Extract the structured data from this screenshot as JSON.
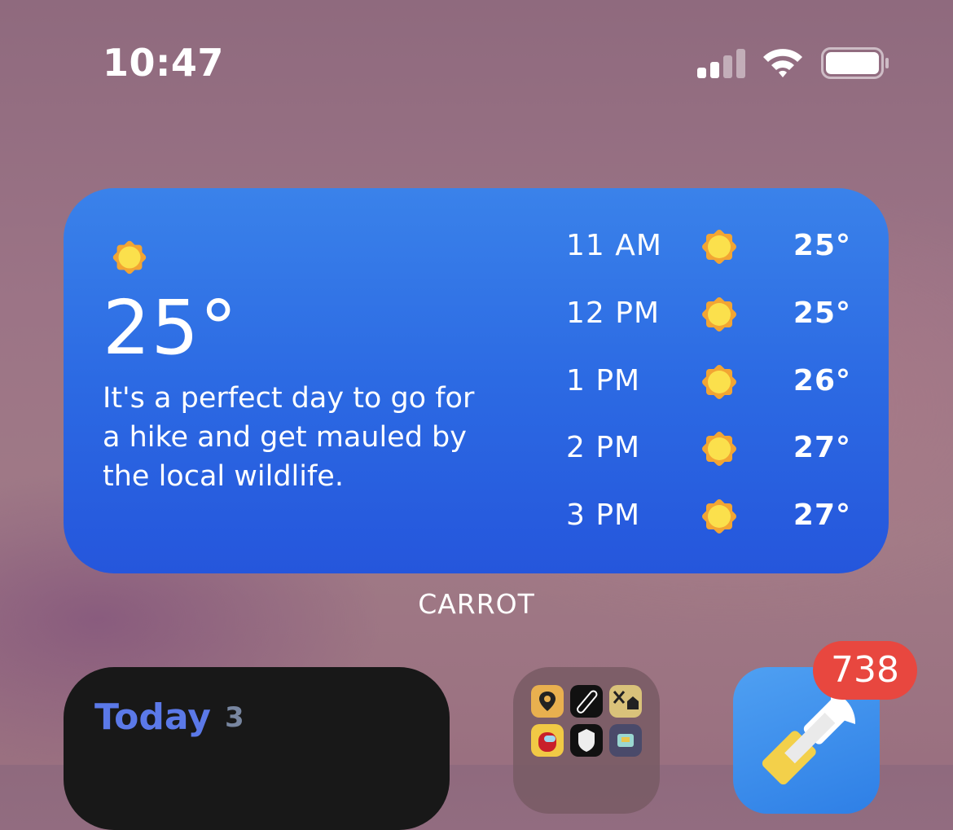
{
  "status_bar": {
    "time": "10:47",
    "signal_icon": "cellular-signal-icon",
    "wifi_icon": "wifi-icon",
    "battery_icon": "battery-icon"
  },
  "weather_widget": {
    "current_icon": "sun-icon",
    "current_temp": "25°",
    "description": "It's a perfect day to go for a hike and get mauled by the local wildlife.",
    "hourly": [
      {
        "time": "11 AM",
        "icon": "sun-icon",
        "temp": "25°"
      },
      {
        "time": "12 PM",
        "icon": "sun-icon",
        "temp": "25°"
      },
      {
        "time": "1 PM",
        "icon": "sun-icon",
        "temp": "26°"
      },
      {
        "time": "2 PM",
        "icon": "sun-icon",
        "temp": "27°"
      },
      {
        "time": "3 PM",
        "icon": "sun-icon",
        "temp": "27°"
      }
    ],
    "caption": "CARROT"
  },
  "reminders_widget": {
    "title": "Today",
    "count": "3"
  },
  "folder": {
    "apps": [
      "map-pin-icon",
      "skateboard-icon",
      "tools-house-icon",
      "among-us-icon",
      "shield-icon",
      "robot-icon"
    ]
  },
  "app": {
    "icon": "satellite-icon",
    "badge": "738"
  },
  "colors": {
    "widget_top": "#3a82ea",
    "widget_bottom": "#2556dc",
    "badge": "#e8473f",
    "reminders_title": "#5b79e8"
  }
}
